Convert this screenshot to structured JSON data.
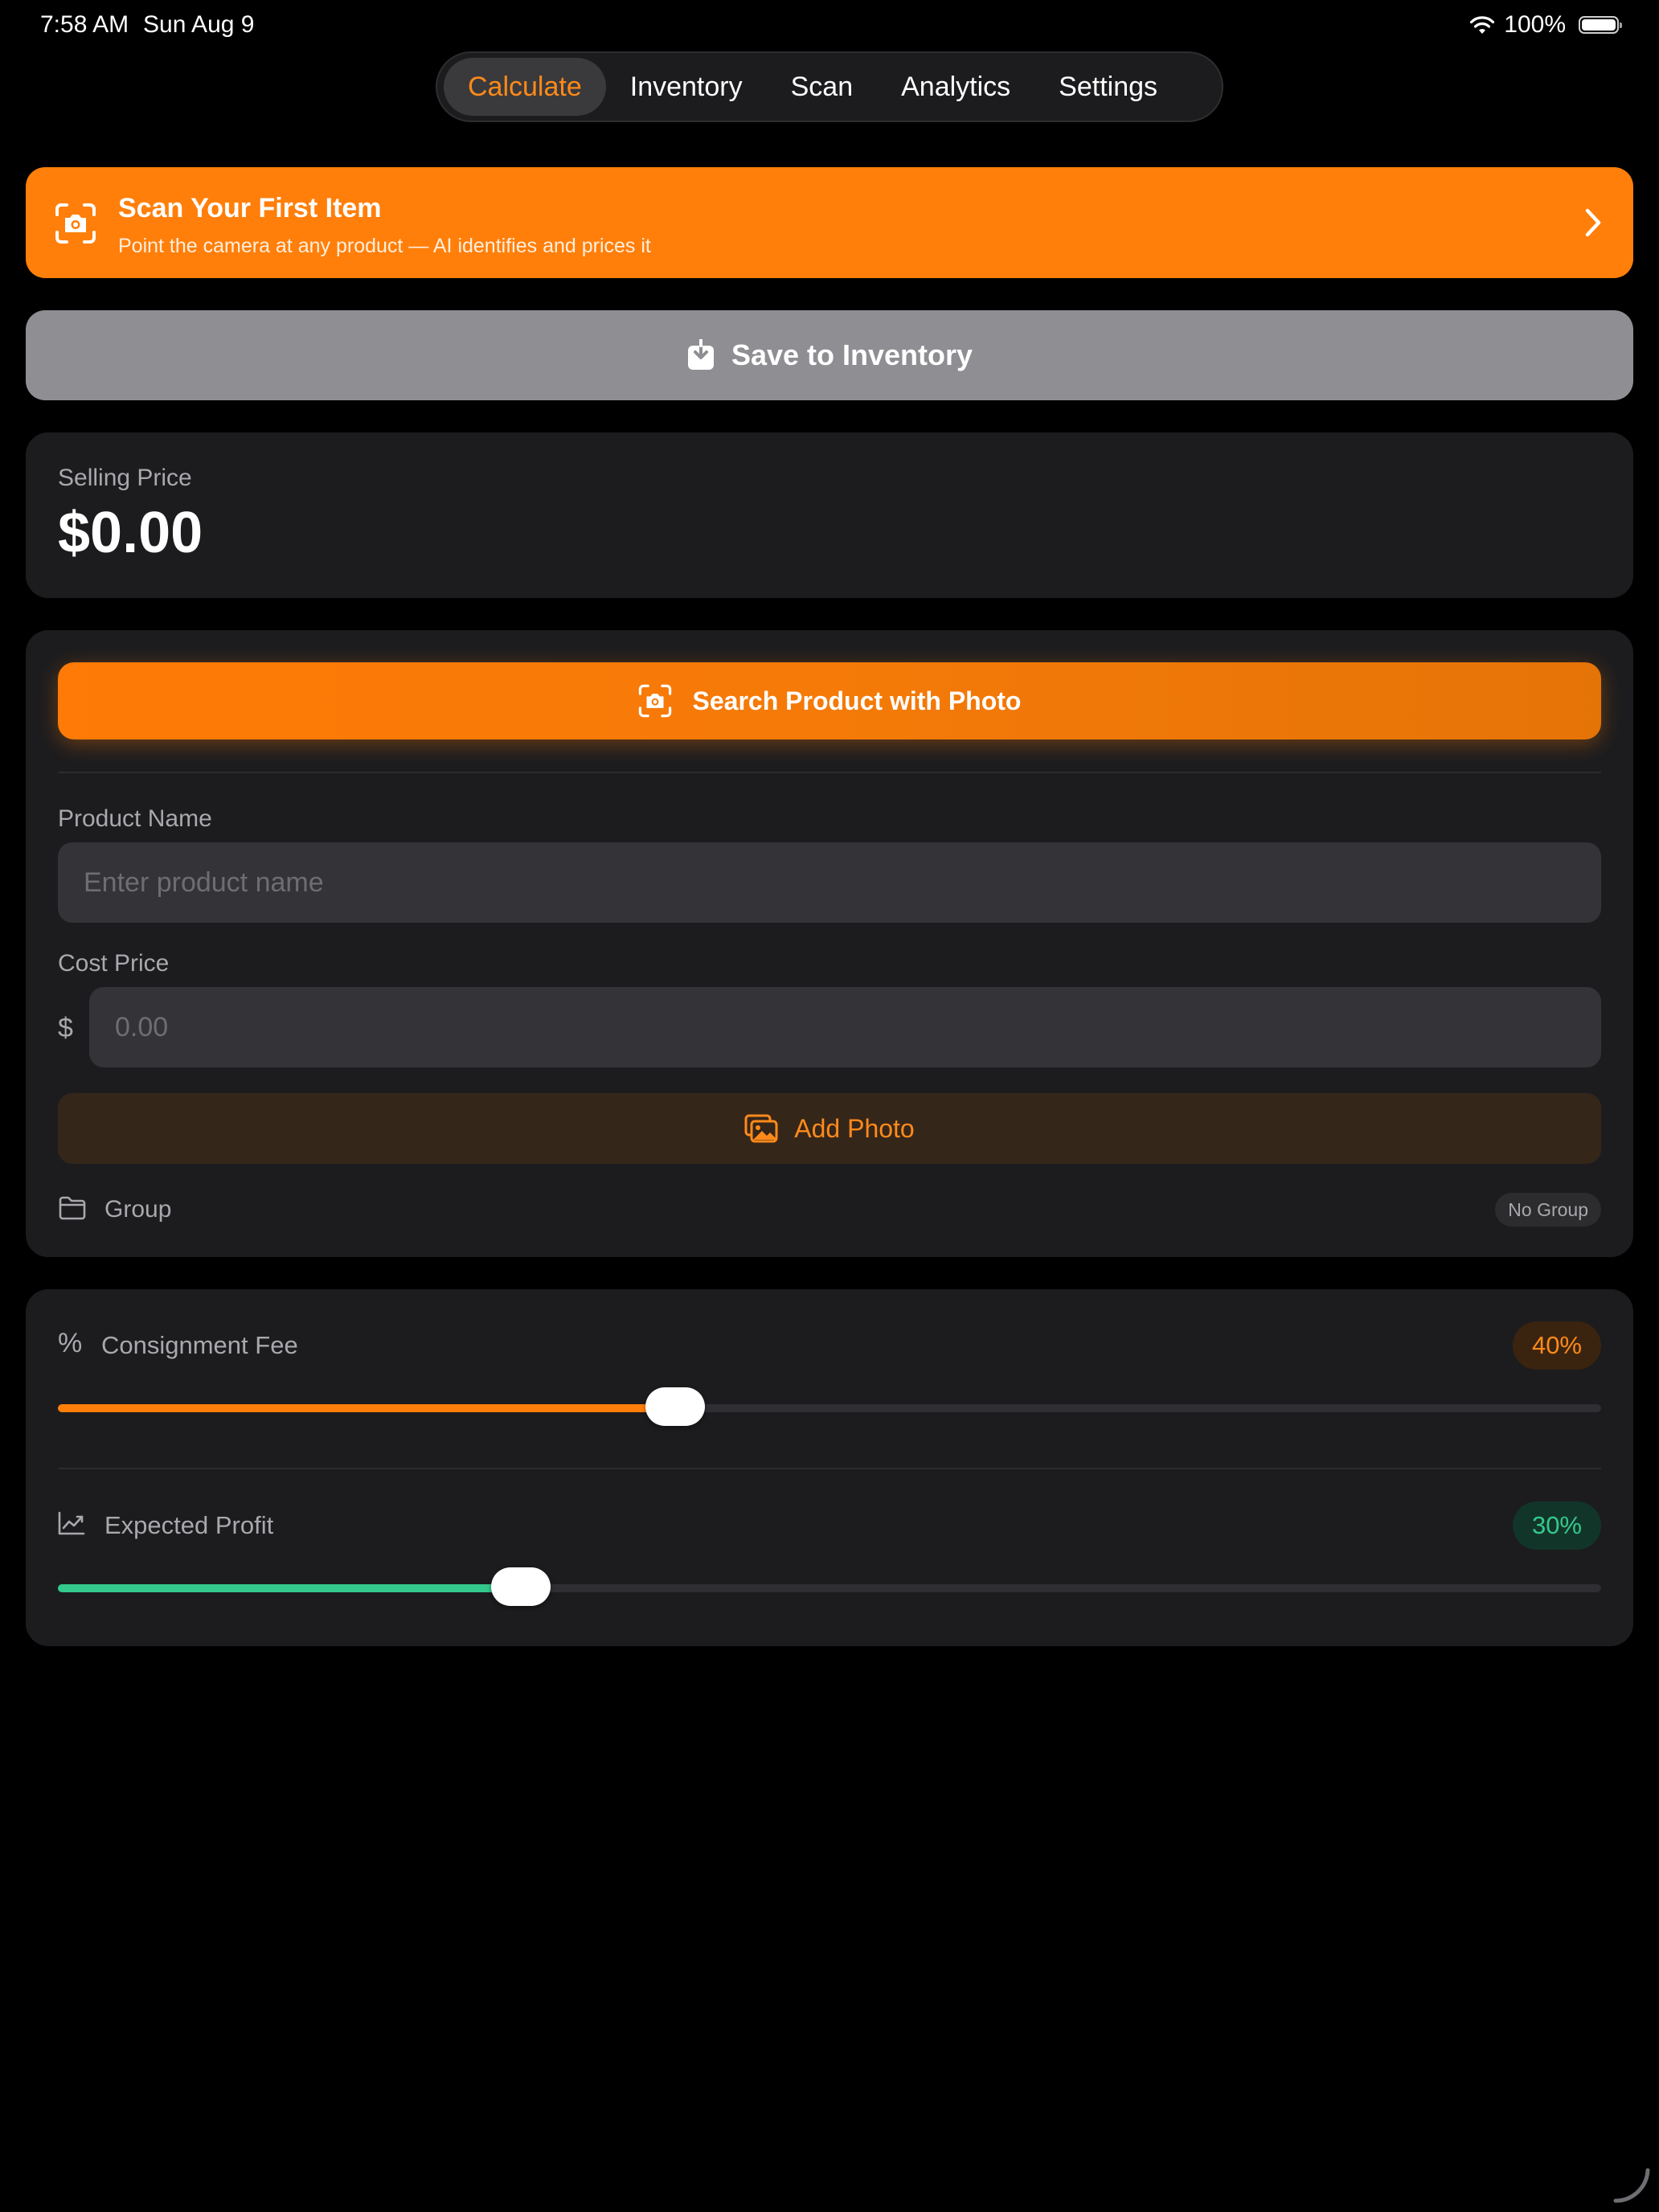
{
  "status_bar": {
    "time": "7:58 AM",
    "date": "Sun Aug 9",
    "battery": "100%"
  },
  "tabs": [
    {
      "label": "Calculate",
      "active": true
    },
    {
      "label": "Inventory",
      "active": false
    },
    {
      "label": "Scan",
      "active": false
    },
    {
      "label": "Analytics",
      "active": false
    },
    {
      "label": "Settings",
      "active": false
    }
  ],
  "scan_banner": {
    "title": "Scan Your First Item",
    "subtitle": "Point the camera at any product — AI identifies and prices it",
    "icon": "camera-scan-icon"
  },
  "save_button": {
    "label": "Save to Inventory",
    "icon": "tray-download-icon"
  },
  "selling": {
    "label": "Selling Price",
    "value": "$0.00"
  },
  "form": {
    "search_photo_label": "Search Product with Photo",
    "product_name_label": "Product Name",
    "product_name_placeholder": "Enter product name",
    "product_name_value": "",
    "cost_price_label": "Cost Price",
    "currency_symbol": "$",
    "cost_price_placeholder": "0.00",
    "cost_price_value": "",
    "add_photo_label": "Add Photo",
    "group_label": "Group",
    "group_value": "No Group"
  },
  "sliders": {
    "consignment": {
      "icon_text": "%",
      "label": "Consignment Fee",
      "value_text": "40%",
      "fraction": 0.4
    },
    "profit": {
      "label": "Expected Profit",
      "value_text": "30%",
      "fraction": 0.3
    }
  },
  "colors": {
    "accent": "#ff7f0a",
    "profit_green": "#34c98c",
    "card_bg": "#1c1c1e",
    "save_button_bg": "#8e8e93"
  }
}
